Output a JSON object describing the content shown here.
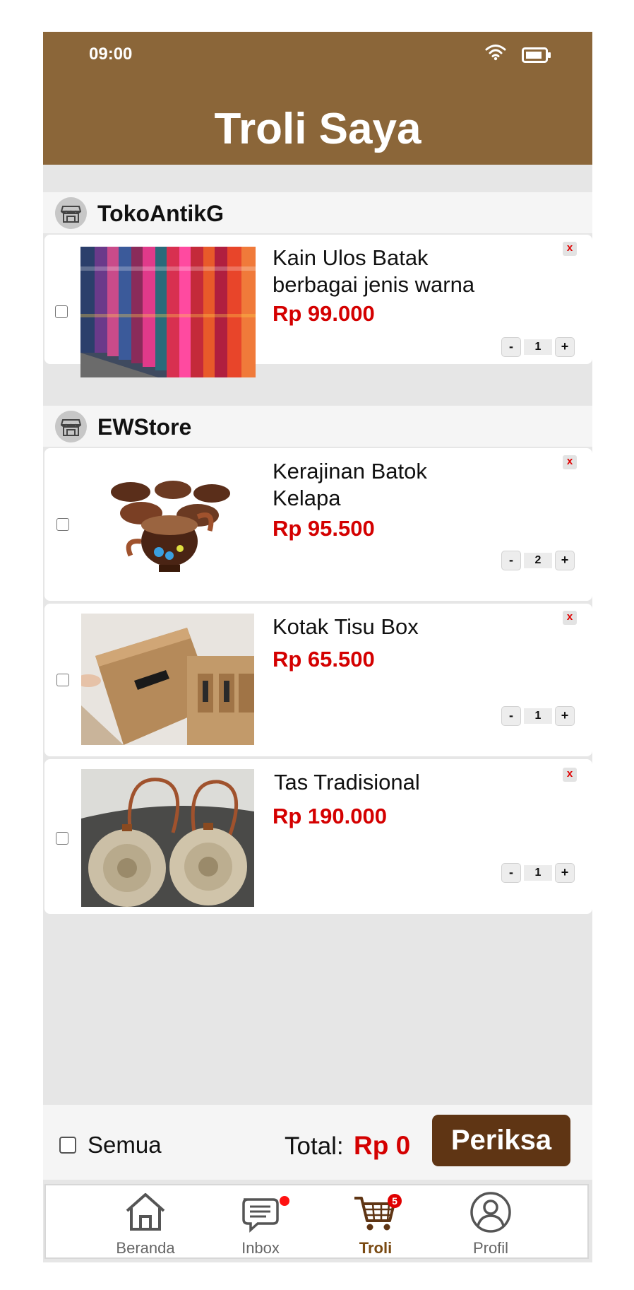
{
  "status_bar": {
    "time": "09:00"
  },
  "header": {
    "title": "Troli Saya"
  },
  "shops": [
    {
      "name": "TokoAntikG",
      "items": [
        {
          "name_line1": "Kain Ulos Batak",
          "name_line2": "berbagai jenis warna",
          "price": "Rp 99.000",
          "qty": "1",
          "delete_label": "x"
        }
      ]
    },
    {
      "name": "EWStore",
      "items": [
        {
          "name_line1": "Kerajinan Batok",
          "name_line2": "Kelapa",
          "price": "Rp 95.500",
          "qty": "2",
          "delete_label": "x"
        },
        {
          "name_line1": "Kotak Tisu Box",
          "name_line2": "",
          "price": "Rp 65.500",
          "qty": "1",
          "delete_label": "x"
        },
        {
          "name_line1": "Tas Tradisional",
          "name_line2": "",
          "price": "Rp 190.000",
          "qty": "1",
          "delete_label": "x"
        }
      ]
    }
  ],
  "stepper": {
    "minus": "-",
    "plus": "+"
  },
  "footer": {
    "select_all_label": "Semua",
    "total_label": "Total:",
    "total_value": "Rp 0",
    "checkout_label": "Periksa"
  },
  "nav": {
    "items": [
      {
        "label": "Beranda",
        "icon": "home-icon"
      },
      {
        "label": "Inbox",
        "icon": "chat-icon"
      },
      {
        "label": "Troli",
        "icon": "cart-icon",
        "badge": "5"
      },
      {
        "label": "Profil",
        "icon": "user-icon"
      }
    ]
  },
  "colors": {
    "brand": "#8b6639",
    "checkout": "#5f3514",
    "price": "#d40000"
  }
}
